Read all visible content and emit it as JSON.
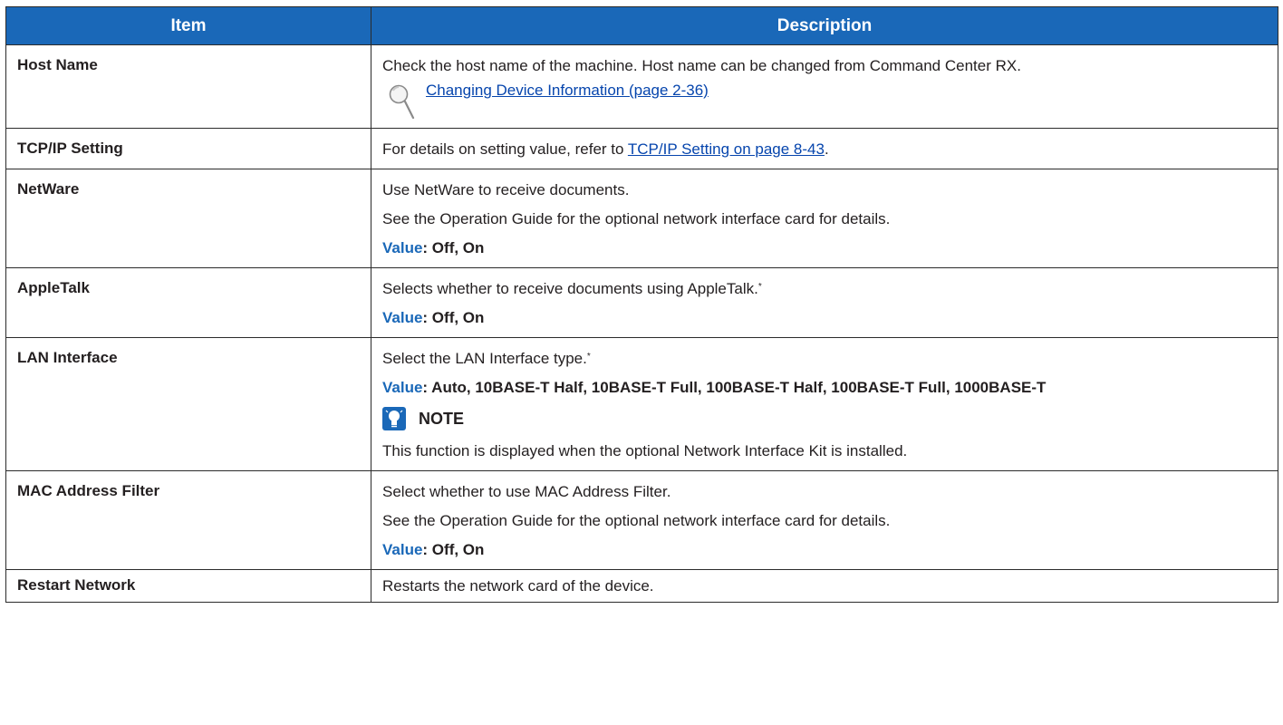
{
  "table": {
    "headers": [
      "Item",
      "Description"
    ],
    "rows": [
      {
        "item": "Host Name",
        "desc": [
          "Check the host name of the machine. Host name can be changed from Command Center RX."
        ],
        "ref_icon": "magnifier-reference-icon",
        "link": "Changing Device Information (page 2-36)"
      },
      {
        "item": "TCP/IP Setting",
        "desc_prefix": "For details on setting value, refer to ",
        "link": "TCP/IP Setting on page 8-43",
        "desc_suffix": "."
      },
      {
        "item": "NetWare",
        "desc": [
          "Use NetWare to receive documents.",
          "See the Operation Guide for the optional network interface card for details."
        ],
        "value_key": "Value",
        "value": ": Off, On"
      },
      {
        "item": "AppleTalk",
        "desc": [
          "Selects whether to receive documents using AppleTalk."
        ],
        "footnote": "*",
        "value_key": "Value",
        "value": ": Off, On"
      },
      {
        "item": "LAN Interface",
        "desc": [
          "Select the LAN Interface type."
        ],
        "footnote": "*",
        "value_key": "Value",
        "value": ": Auto, 10BASE-T Half, 10BASE-T Full, 100BASE-T Half, 100BASE-T Full, 1000BASE-T",
        "note_icon": "note-lightbulb-icon",
        "note_title": "NOTE",
        "note_text": "This function is displayed when the optional Network Interface Kit is installed."
      },
      {
        "item": "MAC Address Filter",
        "desc": [
          "Select whether to use MAC Address Filter.",
          "See the Operation Guide for the optional network interface card for details."
        ],
        "value_key": "Value",
        "value": ": Off, On"
      },
      {
        "item": "Restart Network",
        "desc": [
          "Restarts the network card of the device."
        ]
      }
    ]
  },
  "colors": {
    "header_bg": "#1a68b8",
    "value_key": "#1a68b8",
    "link": "#0645ad",
    "text": "#231f20"
  }
}
